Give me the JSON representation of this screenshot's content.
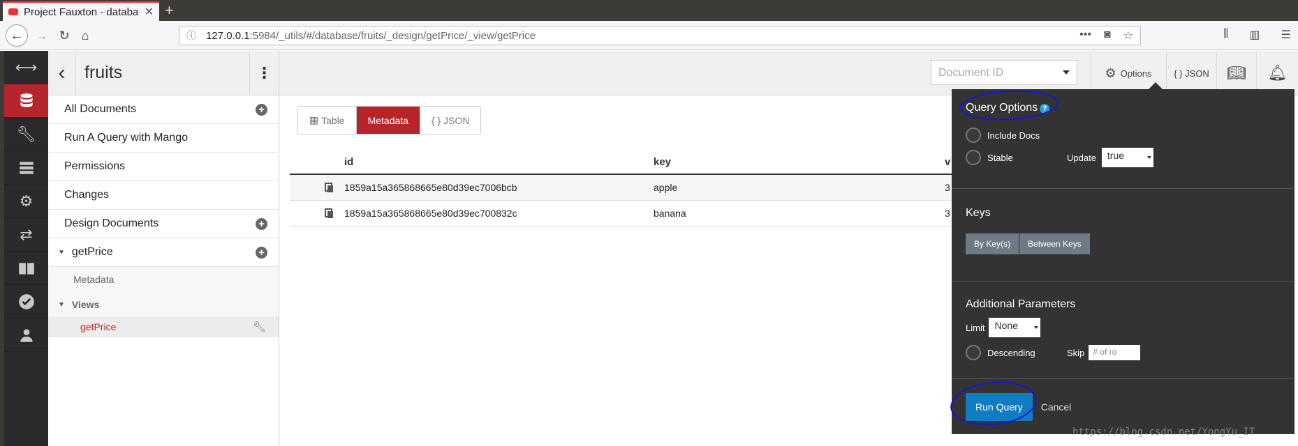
{
  "browser": {
    "tab_title": "Project Fauxton - databa",
    "url_host": "127.0.0.1",
    "url_rest": ":5984/_utils/#/database/fruits/_design/getPrice/_view/getPrice"
  },
  "app_nav": {
    "items": [
      "expand-icon",
      "database-icon",
      "wrench-icon",
      "server-icon",
      "gear-icon",
      "replication-icon",
      "docs-icon",
      "verify-icon",
      "user-icon"
    ]
  },
  "sidebar": {
    "db_name": "fruits",
    "items": [
      {
        "label": "All Documents"
      },
      {
        "label": "Run A Query with Mango"
      },
      {
        "label": "Permissions"
      },
      {
        "label": "Changes"
      },
      {
        "label": "Design Documents"
      }
    ],
    "design_doc": "getPrice",
    "metadata_label": "Metadata",
    "views_label": "Views",
    "view_name": "getPrice"
  },
  "header": {
    "doc_id_placeholder": "Document ID",
    "options_label": "Options",
    "json_label": "{ } JSON"
  },
  "view_toggle": {
    "table": "Table",
    "metadata": "Metadata",
    "json": "{ } JSON"
  },
  "table": {
    "columns": [
      "id",
      "key",
      "v"
    ],
    "rows": [
      {
        "id": "1859a15a365868665e80d39ec7006bcb",
        "key": "apple",
        "value": "3"
      },
      {
        "id": "1859a15a365868665e80d39ec700832c",
        "key": "banana",
        "value": "3"
      }
    ]
  },
  "options_panel": {
    "query_options_title": "Query Options",
    "include_docs": "Include Docs",
    "stable": "Stable",
    "update_label": "Update",
    "update_value": "true",
    "keys_title": "Keys",
    "by_keys": "By Key(s)",
    "between_keys": "Between Keys",
    "additional_title": "Additional Parameters",
    "limit_label": "Limit",
    "limit_value": "None",
    "descending": "Descending",
    "skip_label": "Skip",
    "skip_placeholder": "# of ro",
    "run_query": "Run Query",
    "cancel": "Cancel"
  },
  "watermark": "https://blog.csdn.net/YongYu_IT",
  "colors": {
    "accent": "#b6252a",
    "primary_button": "#127cc0",
    "annotation": "#1515d8"
  }
}
